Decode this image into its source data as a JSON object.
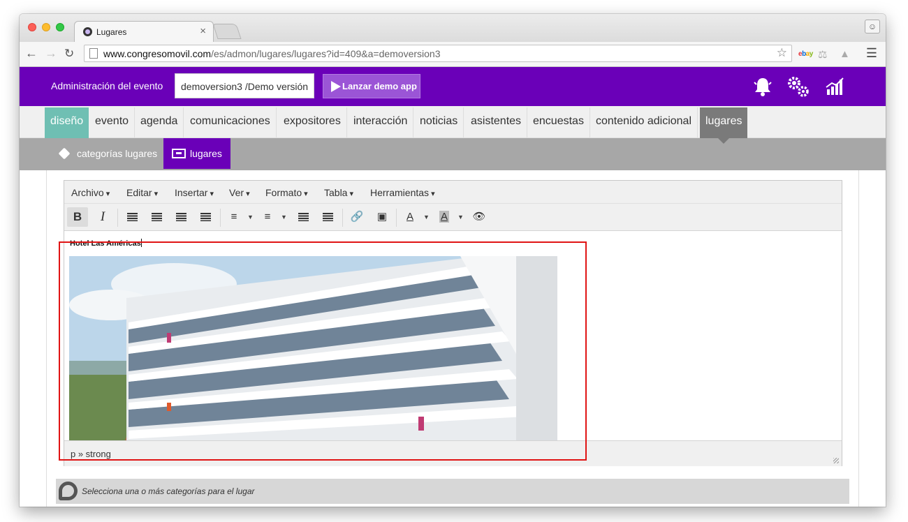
{
  "browser": {
    "tab_title": "Lugares",
    "tab_close": "×",
    "url_host": "www.congresomovil.com",
    "url_path": "/es/admon/lugares/lugares?id=409&a=demoversion3"
  },
  "admin": {
    "title": "Administración del evento",
    "event_value": "demoversion3 /Demo versión",
    "launch_label": "Lanzar demo app",
    "icons": [
      "bell-icon",
      "gears-icon",
      "stats-icon"
    ]
  },
  "main_nav": {
    "items": [
      "diseño",
      "evento",
      "agenda",
      "comunicaciones",
      "expositores",
      "interacción",
      "noticias",
      "asistentes",
      "encuestas",
      "contenido adicional",
      "lugares"
    ]
  },
  "sub_nav": {
    "categories_label": "categorías lugares",
    "places_label": "lugares"
  },
  "editor": {
    "menus": [
      "Archivo",
      "Editar",
      "Insertar",
      "Ver",
      "Formato",
      "Tabla",
      "Herramientas"
    ],
    "bold": "B",
    "italic": "I",
    "text_color": "A",
    "bg_color": "A",
    "content_title": "Hotel Las Américas",
    "status_path": "p » strong"
  },
  "info": {
    "text": "Selecciona una o más categorías para el lugar"
  },
  "colors": {
    "brand": "#6a00b8",
    "design_tab": "#6fbfb3",
    "highlight": "#e01414"
  }
}
